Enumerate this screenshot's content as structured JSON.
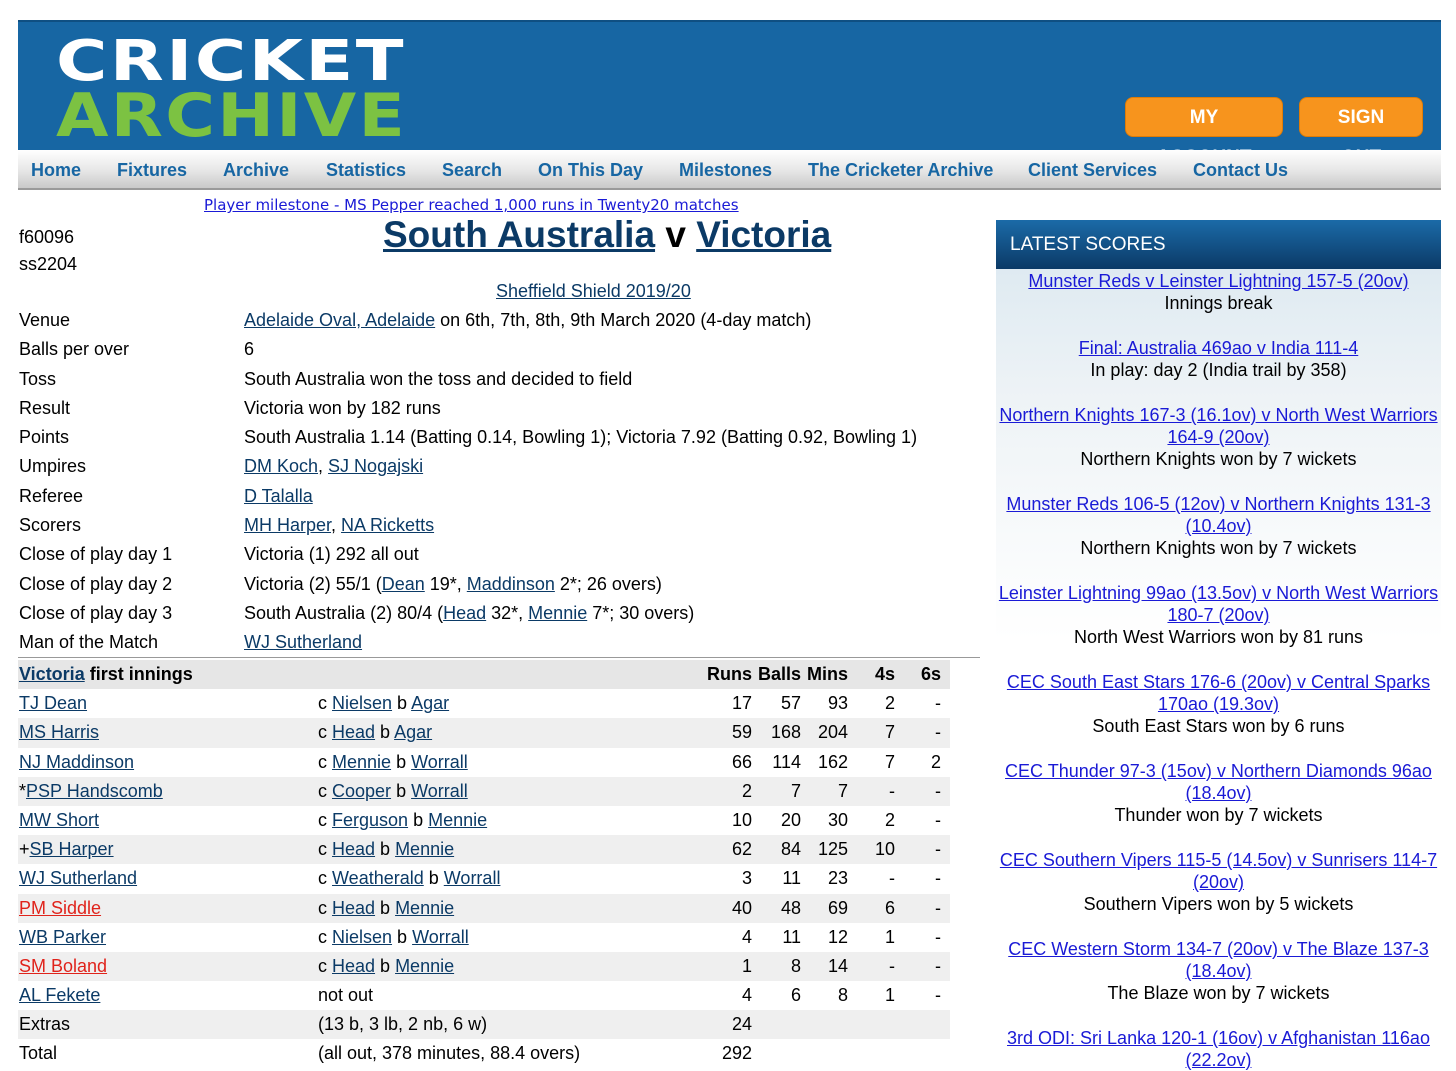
{
  "header": {
    "logo_top": "CRICKET",
    "logo_bottom": "ARCHIVE",
    "my_account": "MY ACCOUNT",
    "sign_out": "SIGN OUT"
  },
  "nav": [
    "Home",
    "Fixtures",
    "Archive",
    "Statistics",
    "Search",
    "On This Day",
    "Milestones",
    "The Cricketer Archive",
    "Client Services",
    "Contact Us"
  ],
  "milestone": "Player milestone - MS Pepper reached 1,000 runs in Twenty20 matches",
  "ids": [
    "f60096",
    "ss2204"
  ],
  "match": {
    "home": "South Australia",
    "v": "v",
    "away": "Victoria",
    "competition": "Sheffield Shield 2019/20"
  },
  "details": {
    "venue_label": "Venue",
    "venue_link": "Adelaide Oval, Adelaide",
    "venue_rest": " on 6th, 7th, 8th, 9th March 2020 (4-day match)",
    "bpo_label": "Balls per over",
    "bpo": "6",
    "toss_label": "Toss",
    "toss": "South Australia won the toss and decided to field",
    "result_label": "Result",
    "result": "Victoria won by 182 runs",
    "points_label": "Points",
    "points": "South Australia 1.14 (Batting 0.14, Bowling 1); Victoria 7.92 (Batting 0.92, Bowling 1)",
    "umpires_label": "Umpires",
    "umpire1": "DM Koch",
    "umpire2": "SJ Nogajski",
    "referee_label": "Referee",
    "referee": "D Talalla",
    "scorers_label": "Scorers",
    "scorer1": "MH Harper",
    "scorer2": "NA Ricketts",
    "cop1_label": "Close of play day 1",
    "cop1": "Victoria (1) 292 all out",
    "cop2_label": "Close of play day 2",
    "cop2_a": "Victoria (2) 55/1 (",
    "cop2_p1": "Dean",
    "cop2_b": " 19*, ",
    "cop2_p2": "Maddinson",
    "cop2_c": " 2*; 26 overs)",
    "cop3_label": "Close of play day 3",
    "cop3_a": "South Australia (2) 80/4 (",
    "cop3_p1": "Head",
    "cop3_b": " 32*, ",
    "cop3_p2": "Mennie",
    "cop3_c": " 7*; 30 overs)",
    "motm_label": "Man of the Match",
    "motm": "WJ Sutherland"
  },
  "innings": {
    "team": "Victoria",
    "title_rest": " first innings",
    "headers": [
      "Runs",
      "Balls",
      "Mins",
      "4s",
      "6s"
    ],
    "rows": [
      {
        "name": "TJ Dean",
        "pre": "",
        "d": "c",
        "f": "Nielsen",
        "b": "Agar",
        "runs": "17",
        "balls": "57",
        "mins": "93",
        "fours": "2",
        "sixes": "-",
        "red": false
      },
      {
        "name": "MS Harris",
        "pre": "",
        "d": "c",
        "f": "Head",
        "b": "Agar",
        "runs": "59",
        "balls": "168",
        "mins": "204",
        "fours": "7",
        "sixes": "-",
        "red": false
      },
      {
        "name": "NJ Maddinson",
        "pre": "",
        "d": "c",
        "f": "Mennie",
        "b": "Worrall",
        "runs": "66",
        "balls": "114",
        "mins": "162",
        "fours": "7",
        "sixes": "2",
        "red": false
      },
      {
        "name": "PSP Handscomb",
        "pre": "*",
        "d": "c",
        "f": "Cooper",
        "b": "Worrall",
        "runs": "2",
        "balls": "7",
        "mins": "7",
        "fours": "-",
        "sixes": "-",
        "red": false
      },
      {
        "name": "MW Short",
        "pre": "",
        "d": "c",
        "f": "Ferguson",
        "b": "Mennie",
        "runs": "10",
        "balls": "20",
        "mins": "30",
        "fours": "2",
        "sixes": "-",
        "red": false
      },
      {
        "name": "SB Harper",
        "pre": "+",
        "d": "c",
        "f": "Head",
        "b": "Mennie",
        "runs": "62",
        "balls": "84",
        "mins": "125",
        "fours": "10",
        "sixes": "-",
        "red": false
      },
      {
        "name": "WJ Sutherland",
        "pre": "",
        "d": "c",
        "f": "Weatherald",
        "b": "Worrall",
        "runs": "3",
        "balls": "11",
        "mins": "23",
        "fours": "-",
        "sixes": "-",
        "red": false
      },
      {
        "name": "PM Siddle",
        "pre": "",
        "d": "c",
        "f": "Head",
        "b": "Mennie",
        "runs": "40",
        "balls": "48",
        "mins": "69",
        "fours": "6",
        "sixes": "-",
        "red": true
      },
      {
        "name": "WB Parker",
        "pre": "",
        "d": "c",
        "f": "Nielsen",
        "b": "Worrall",
        "runs": "4",
        "balls": "11",
        "mins": "12",
        "fours": "1",
        "sixes": "-",
        "red": false
      },
      {
        "name": "SM Boland",
        "pre": "",
        "d": "c",
        "f": "Head",
        "b": "Mennie",
        "runs": "1",
        "balls": "8",
        "mins": "14",
        "fours": "-",
        "sixes": "-",
        "red": true
      },
      {
        "name": "AL Fekete",
        "pre": "",
        "d": "not out",
        "f": "",
        "b": "",
        "runs": "4",
        "balls": "6",
        "mins": "8",
        "fours": "1",
        "sixes": "-",
        "red": false
      }
    ],
    "extras_label": "Extras",
    "extras_detail": "(13 b, 3 lb, 2 nb, 6 w)",
    "extras": "24",
    "total_label": "Total",
    "total_detail": "(all out, 378 minutes, 88.4 overs)",
    "total": "292"
  },
  "sidebar": {
    "title": "LATEST SCORES",
    "scores": [
      {
        "link": "Munster Reds v Leinster Lightning 157-5 (20ov)",
        "status": "Innings break"
      },
      {
        "link": "Final: Australia 469ao v India 111-4",
        "status": "In play: day 2 (India trail by 358)"
      },
      {
        "link": "Northern Knights 167-3 (16.1ov) v North West Warriors 164-9 (20ov)",
        "status": "Northern Knights won by 7 wickets"
      },
      {
        "link": "Munster Reds 106-5 (12ov) v Northern Knights 131-3 (10.4ov)",
        "status": "Northern Knights won by 7 wickets"
      },
      {
        "link": "Leinster Lightning 99ao (13.5ov) v North West Warriors 180-7 (20ov)",
        "status": "North West Warriors won by 81 runs"
      },
      {
        "link": "CEC South East Stars 176-6 (20ov) v Central Sparks 170ao (19.3ov)",
        "status": "South East Stars won by 6 runs"
      },
      {
        "link": "CEC Thunder 97-3 (15ov) v Northern Diamonds 96ao (18.4ov)",
        "status": "Thunder won by 7 wickets"
      },
      {
        "link": "CEC Southern Vipers 115-5 (14.5ov) v Sunrisers 114-7 (20ov)",
        "status": "Southern Vipers won by 5 wickets"
      },
      {
        "link": "CEC Western Storm 134-7 (20ov) v The Blaze 137-3 (18.4ov)",
        "status": "The Blaze won by 7 wickets"
      },
      {
        "link": "3rd ODI: Sri Lanka 120-1 (16ov) v Afghanistan 116ao (22.2ov)",
        "status": ""
      }
    ]
  }
}
